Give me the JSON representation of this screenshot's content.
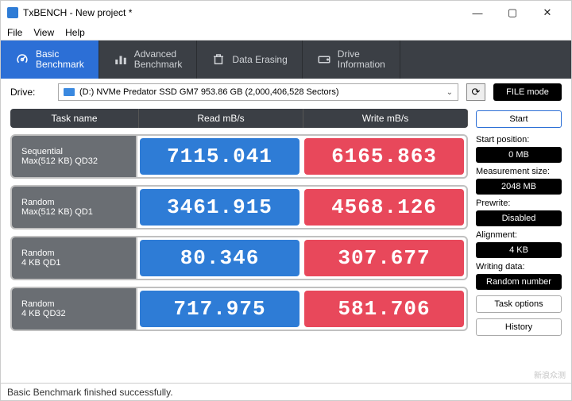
{
  "window": {
    "title": "TxBENCH - New project *"
  },
  "menu": {
    "file": "File",
    "view": "View",
    "help": "Help"
  },
  "tabs": {
    "basic": "Basic\nBenchmark",
    "advanced": "Advanced\nBenchmark",
    "erasing": "Data Erasing",
    "info": "Drive\nInformation"
  },
  "drive": {
    "label": "Drive:",
    "selected": "(D:) NVMe Predator SSD GM7  953.86 GB (2,000,406,528 Sectors)",
    "filemode": "FILE mode"
  },
  "headers": {
    "task": "Task name",
    "read": "Read mB/s",
    "write": "Write mB/s"
  },
  "rows": [
    {
      "name1": "Sequential",
      "name2": "Max(512 KB) QD32",
      "read": "7115.041",
      "write": "6165.863"
    },
    {
      "name1": "Random",
      "name2": "Max(512 KB) QD1",
      "read": "3461.915",
      "write": "4568.126"
    },
    {
      "name1": "Random",
      "name2": "4 KB QD1",
      "read": "80.346",
      "write": "307.677"
    },
    {
      "name1": "Random",
      "name2": "4 KB QD32",
      "read": "717.975",
      "write": "581.706"
    }
  ],
  "sidebar": {
    "start": "Start",
    "startpos_label": "Start position:",
    "startpos_value": "0 MB",
    "meas_label": "Measurement size:",
    "meas_value": "2048 MB",
    "prewrite_label": "Prewrite:",
    "prewrite_value": "Disabled",
    "align_label": "Alignment:",
    "align_value": "4 KB",
    "wdata_label": "Writing data:",
    "wdata_value": "Random number",
    "taskopt": "Task options",
    "history": "History"
  },
  "status": "Basic Benchmark finished successfully.",
  "watermark": "新浪众测",
  "colors": {
    "read": "#2e7cd6",
    "write": "#e8485b",
    "task": "#6a6e73",
    "tabbar": "#3b3f45",
    "active": "#2c6fd6"
  },
  "chart_data": {
    "type": "table",
    "title": "TxBENCH Basic Benchmark",
    "columns": [
      "Task name",
      "Read mB/s",
      "Write mB/s"
    ],
    "rows": [
      [
        "Sequential Max(512 KB) QD32",
        7115.041,
        6165.863
      ],
      [
        "Random Max(512 KB) QD1",
        3461.915,
        4568.126
      ],
      [
        "Random 4 KB QD1",
        80.346,
        307.677
      ],
      [
        "Random 4 KB QD32",
        717.975,
        581.706
      ]
    ]
  }
}
